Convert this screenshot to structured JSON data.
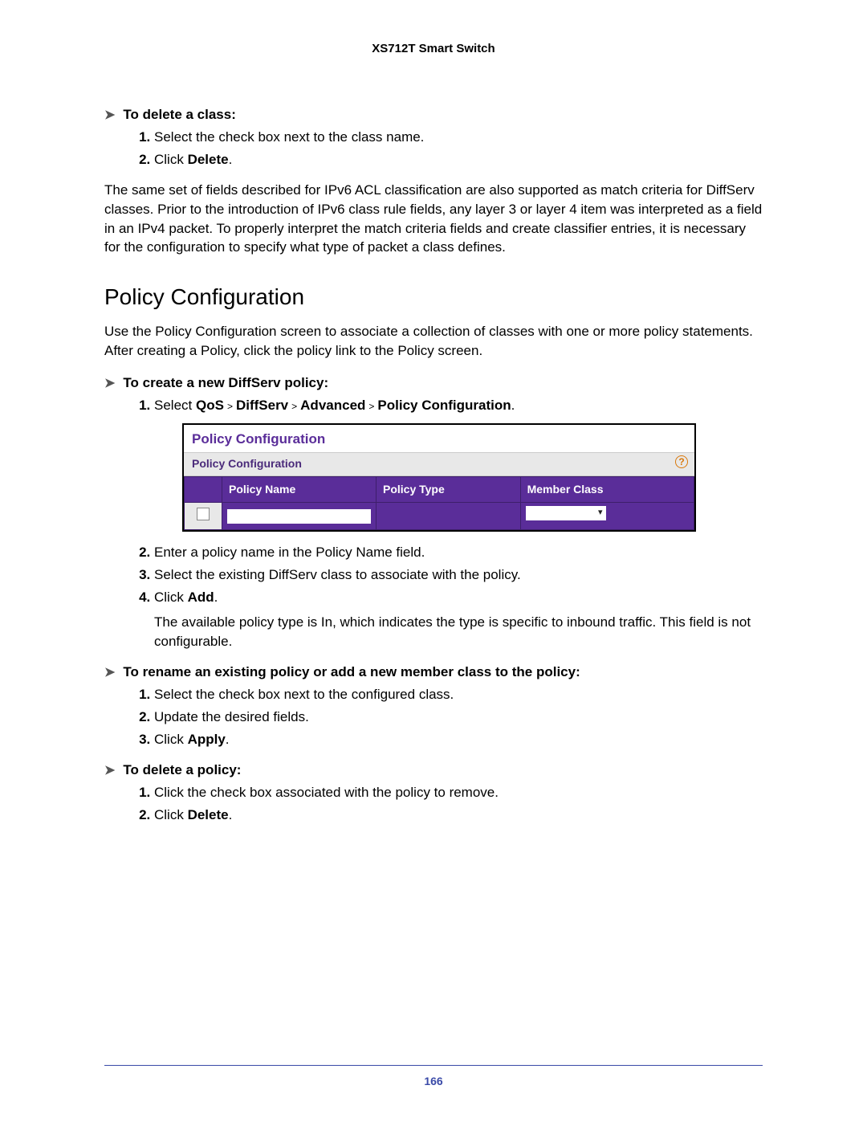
{
  "header": {
    "doc_title": "XS712T Smart Switch"
  },
  "sec1": {
    "title": "To delete a class:",
    "steps": {
      "1": "Select the check box next to the class name.",
      "2a": "Click ",
      "2b": "Delete",
      "2c": "."
    }
  },
  "para_acl": "The same set of fields described for IPv6 ACL classification are also supported as match criteria for DiffServ classes. Prior to the introduction of IPv6 class rule fields, any layer 3 or layer 4 item was interpreted as a field in an IPv4 packet. To properly interpret the match criteria fields and create classifier entries, it is necessary for the configuration to specify what type of packet a class defines.",
  "section_heading": "Policy Configuration",
  "para_policy": "Use the Policy Configuration screen to associate a collection of classes with one or more policy statements. After creating a Policy, click the policy link to the Policy screen.",
  "sec2": {
    "title": "To create a new DiffServ policy:",
    "step1_pre": "Select ",
    "step1_p1": "QoS",
    "step1_p2": "DiffServ",
    "step1_p3": "Advanced",
    "step1_p4": "Policy Configuration",
    "step1_post": ".",
    "step2": "Enter a policy name in the Policy Name field.",
    "step3": "Select the existing DiffServ class to associate with the policy.",
    "step4a": "Click ",
    "step4b": "Add",
    "step4c": ".",
    "note": "The available policy type is In, which indicates the type is specific to inbound traffic. This field is not configurable."
  },
  "sec3": {
    "title": "To rename an existing policy or add a new member class to the policy:",
    "step1": "Select the check box next to the configured class.",
    "step2": "Update the desired fields.",
    "step3a": "Click ",
    "step3b": "Apply",
    "step3c": "."
  },
  "sec4": {
    "title": "To delete a policy:",
    "step1": "Click the check box associated with the policy to remove.",
    "step2a": "Click ",
    "step2b": "Delete",
    "step2c": "."
  },
  "ui": {
    "title": "Policy Configuration",
    "subhead": "Policy Configuration",
    "help": "?",
    "cols": {
      "name": "Policy Name",
      "type": "Policy Type",
      "member": "Member Class"
    }
  },
  "footer": {
    "page": "166"
  }
}
